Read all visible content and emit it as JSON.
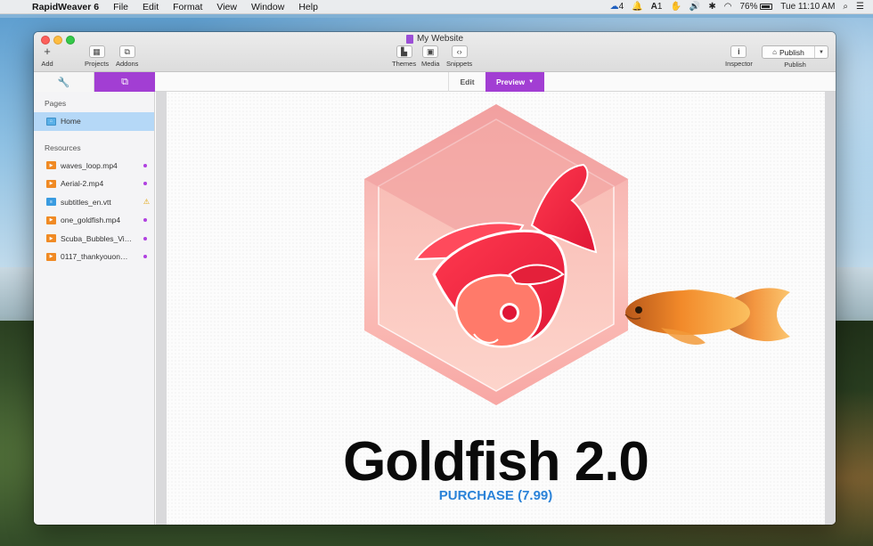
{
  "menubar": {
    "app_name": "RapidWeaver 6",
    "items": [
      "File",
      "Edit",
      "Format",
      "View",
      "Window",
      "Help"
    ],
    "status": {
      "cc_count": "4",
      "adobe_count": "1",
      "battery": "76%",
      "clock": "Tue 11:10 AM"
    }
  },
  "window": {
    "title": "My Website",
    "toolbar": {
      "add": "Add",
      "projects": "Projects",
      "addons": "Addons",
      "themes": "Themes",
      "media": "Media",
      "snippets": "Snippets",
      "inspector": "Inspector",
      "publish_button": "Publish",
      "publish_label": "Publish"
    },
    "modes": {
      "edit": "Edit",
      "preview": "Preview"
    }
  },
  "sidebar": {
    "pages_header": "Pages",
    "pages": [
      {
        "label": "Home",
        "selected": true
      }
    ],
    "resources_header": "Resources",
    "resources": [
      {
        "label": "waves_loop.mp4",
        "kind": "video",
        "marker": "dot"
      },
      {
        "label": "Aerial-2.mp4",
        "kind": "video",
        "marker": "dot"
      },
      {
        "label": "subtitles_en.vtt",
        "kind": "text",
        "marker": "warning"
      },
      {
        "label": "one_goldfish.mp4",
        "kind": "video",
        "marker": "dot"
      },
      {
        "label": "Scuba_Bubbles_Vi…",
        "kind": "video",
        "marker": "dot"
      },
      {
        "label": "0117_thankyouon…",
        "kind": "video",
        "marker": "dot"
      }
    ]
  },
  "preview": {
    "headline": "Goldfish 2.0",
    "purchase": "PURCHASE (7.99)"
  },
  "colors": {
    "accent_purple": "#a23ed3",
    "selection_blue": "#b5d8f7",
    "purchase_blue": "#2a82d8",
    "goldfish_red": "#e8243c"
  }
}
